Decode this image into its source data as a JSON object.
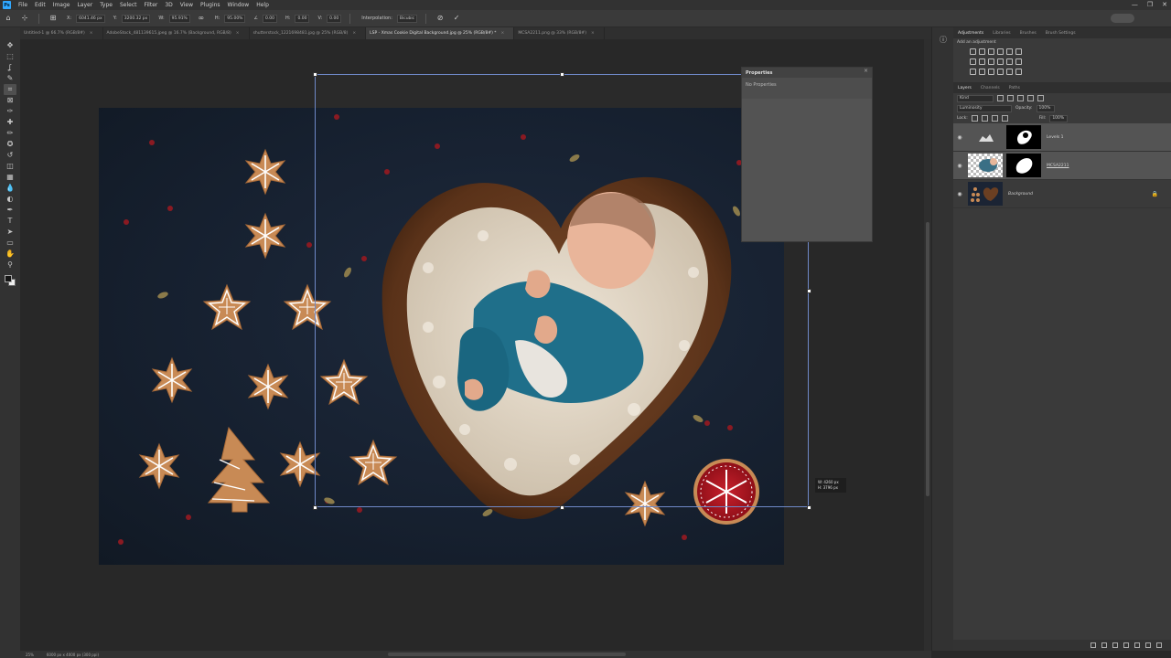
{
  "app": {
    "logo": "Ps"
  },
  "menu": [
    "File",
    "Edit",
    "Image",
    "Layer",
    "Type",
    "Select",
    "Filter",
    "3D",
    "View",
    "Plugins",
    "Window",
    "Help"
  ],
  "window_controls": [
    "—",
    "❐",
    "✕"
  ],
  "options_bar": {
    "x": "6041.46 px",
    "y": "3200.32 px",
    "w": "95.91%",
    "h": "95.00%",
    "angle": "0.00",
    "h_skew": "0.00",
    "v_skew": "0.00",
    "interpolation_label": "Interpolation:",
    "interpolation": "Bicubic",
    "cancel": "⊘",
    "commit": "✓"
  },
  "doc_tabs": [
    {
      "label": "Untitled-1 @ 66.7% (RGB/8#)",
      "active": false
    },
    {
      "label": "AdobeStock_481139615.jpeg @ 16.7% (Background, RGB/8)",
      "active": false
    },
    {
      "label": "shutterstock_1221698481.jpg @ 25% (RGB/8)",
      "active": false
    },
    {
      "label": "LSP - Xmas Cookie Digital Background.jpg @ 25% (RGB/8#) *",
      "active": true
    },
    {
      "label": "MCSA2211.png @ 33% (RGB/8#)",
      "active": false
    }
  ],
  "tools": [
    "move",
    "marquee",
    "lasso",
    "quick-select",
    "crop",
    "frame",
    "eyedropper",
    "healing",
    "brush",
    "stamp",
    "history",
    "eraser",
    "gradient",
    "blur",
    "dodge",
    "pen",
    "type",
    "path-select",
    "rectangle",
    "hand",
    "zoom"
  ],
  "tool_glyphs": [
    "✥",
    "⬚",
    "ʆ",
    "✎",
    "⌗",
    "⊠",
    "✑",
    "✚",
    "✏",
    "✪",
    "↺",
    "◫",
    "▦",
    "💧",
    "◐",
    "✒",
    "T",
    "➤",
    "▭",
    "✋",
    "⚲"
  ],
  "selected_tool": 4,
  "properties": {
    "title": "Properties",
    "message": "No Properties",
    "close": "×"
  },
  "transform": {
    "w": "W: 4260 px",
    "h": "H: 3796 px"
  },
  "right_tabs_top": [
    {
      "label": "Adjustments",
      "active": true
    },
    {
      "label": "Libraries",
      "active": false
    },
    {
      "label": "Brushes",
      "active": false
    },
    {
      "label": "Brush Settings",
      "active": false
    }
  ],
  "adjustments": {
    "hint": "Add an adjustment"
  },
  "right_tabs_layers": [
    {
      "label": "Layers",
      "active": true
    },
    {
      "label": "Channels",
      "active": false
    },
    {
      "label": "Paths",
      "active": false
    }
  ],
  "layers_controls": {
    "kind": "Kind",
    "blend_mode": "Luminosity",
    "opacity_label": "Opacity:",
    "opacity": "100%",
    "lock_label": "Lock:",
    "fill_label": "Fill:",
    "fill": "100%"
  },
  "layers": [
    {
      "name": "Levels 1",
      "selected": true,
      "type": "adjustment"
    },
    {
      "name": "MCSA2211",
      "selected": true,
      "type": "image"
    },
    {
      "name": "Background",
      "selected": false,
      "type": "background"
    }
  ],
  "status": {
    "zoom": "25%",
    "doc_size": "6000 px x 4000 px (300 ppi)"
  }
}
